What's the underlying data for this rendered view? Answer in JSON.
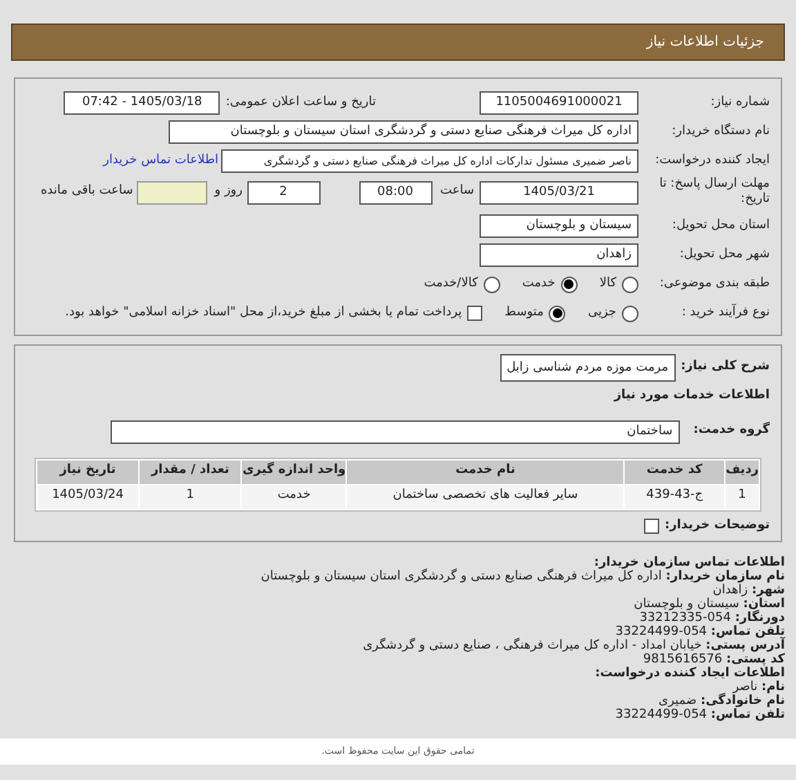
{
  "header": {
    "title": "جزئیات اطلاعات نیاز"
  },
  "need_number": {
    "label": "شماره نیاز:",
    "value": "1105004691000021"
  },
  "announce": {
    "label": "تاریخ و ساعت اعلان عمومی:",
    "value": "1405/03/18 - 07:42"
  },
  "buyer_org": {
    "label": "نام دستگاه خریدار:",
    "value": "اداره کل میراث فرهنگی  صنایع دستی و گردشگری استان سیستان و بلوچستان"
  },
  "requester": {
    "label": "ایجاد کننده درخواست:",
    "value": "ناصر ضمیری مسئول تدارکات اداره کل میراث فرهنگی  صنایع دستی و گردشگری",
    "link": "اطلاعات تماس خریدار"
  },
  "deadline": {
    "label": "مهلت ارسال پاسخ: تا تاریخ:",
    "date": "1405/03/21",
    "time_label": "ساعت",
    "time": "08:00",
    "days": "2",
    "days_label": "روز و",
    "remaining_label": "ساعت باقی مانده"
  },
  "province": {
    "label": "استان محل تحویل:",
    "value": "سیستان و بلوچستان"
  },
  "city": {
    "label": "شهر محل تحویل:",
    "value": "زاهدان"
  },
  "category": {
    "label": "طبقه بندی موضوعی:",
    "options": [
      {
        "label": "کالا",
        "selected": false
      },
      {
        "label": "خدمت",
        "selected": true
      },
      {
        "label": "کالا/خدمت",
        "selected": false
      }
    ]
  },
  "purchase": {
    "label": "نوع فرآیند خرید :",
    "options": [
      {
        "label": "جزیی",
        "selected": false
      },
      {
        "label": "متوسط",
        "selected": true
      }
    ],
    "payment": {
      "label": "پرداخت تمام یا بخشی از مبلغ خرید،از محل \"اسناد خزانه اسلامی\" خواهد بود.",
      "checked": false
    }
  },
  "description": {
    "label": "شرح کلی نیاز:",
    "value": "مرمت موزه مردم شناسی زابل"
  },
  "services_title": "اطلاعات خدمات مورد نیاز",
  "service_group": {
    "label": "گروه خدمت:",
    "value": "ساختمان"
  },
  "table": {
    "columns": [
      "ردیف",
      "کد خدمت",
      "نام خدمت",
      "واحد اندازه گیری",
      "تعداد / مقدار",
      "تاریخ نیاز"
    ],
    "rows": [
      [
        "1",
        "ج-43-439",
        "سایر فعالیت های تخصصی ساختمان",
        "خدمت",
        "1",
        "1405/03/24"
      ]
    ]
  },
  "buyer_notes": {
    "label": "توضیحات خریدار:",
    "checked": false
  },
  "contact": {
    "title": "اطلاعات تماس سازمان خریدار:",
    "lines": [
      {
        "label": "نام سازمان خریدار:",
        "value": "اداره کل میراث فرهنگی صنایع دستی و گردشگری استان سیستان و بلوچستان"
      },
      {
        "label": "شهر:",
        "value": "زاهدان"
      },
      {
        "label": "استان:",
        "value": "سیستان و بلوچستان"
      },
      {
        "label": "دورنگار:",
        "value": "054-33212335"
      },
      {
        "label": "تلفن تماس:",
        "value": "054-33224499"
      },
      {
        "label": "آدرس پستی:",
        "value": "خیابان امداد - اداره کل میراث فرهنگی ، صنایع دستی و گردشگری"
      },
      {
        "label": "کد پستی:",
        "value": "9815616576"
      }
    ]
  },
  "creator": {
    "title": "اطلاعات ایجاد کننده درخواست:",
    "lines": [
      {
        "label": "نام:",
        "value": "ناصر"
      },
      {
        "label": "نام خانوادگی:",
        "value": "ضمیری"
      },
      {
        "label": "تلفن تماس:",
        "value": "054-33224499"
      }
    ]
  },
  "footer": "تمامی حقوق این سایت محفوظ است."
}
